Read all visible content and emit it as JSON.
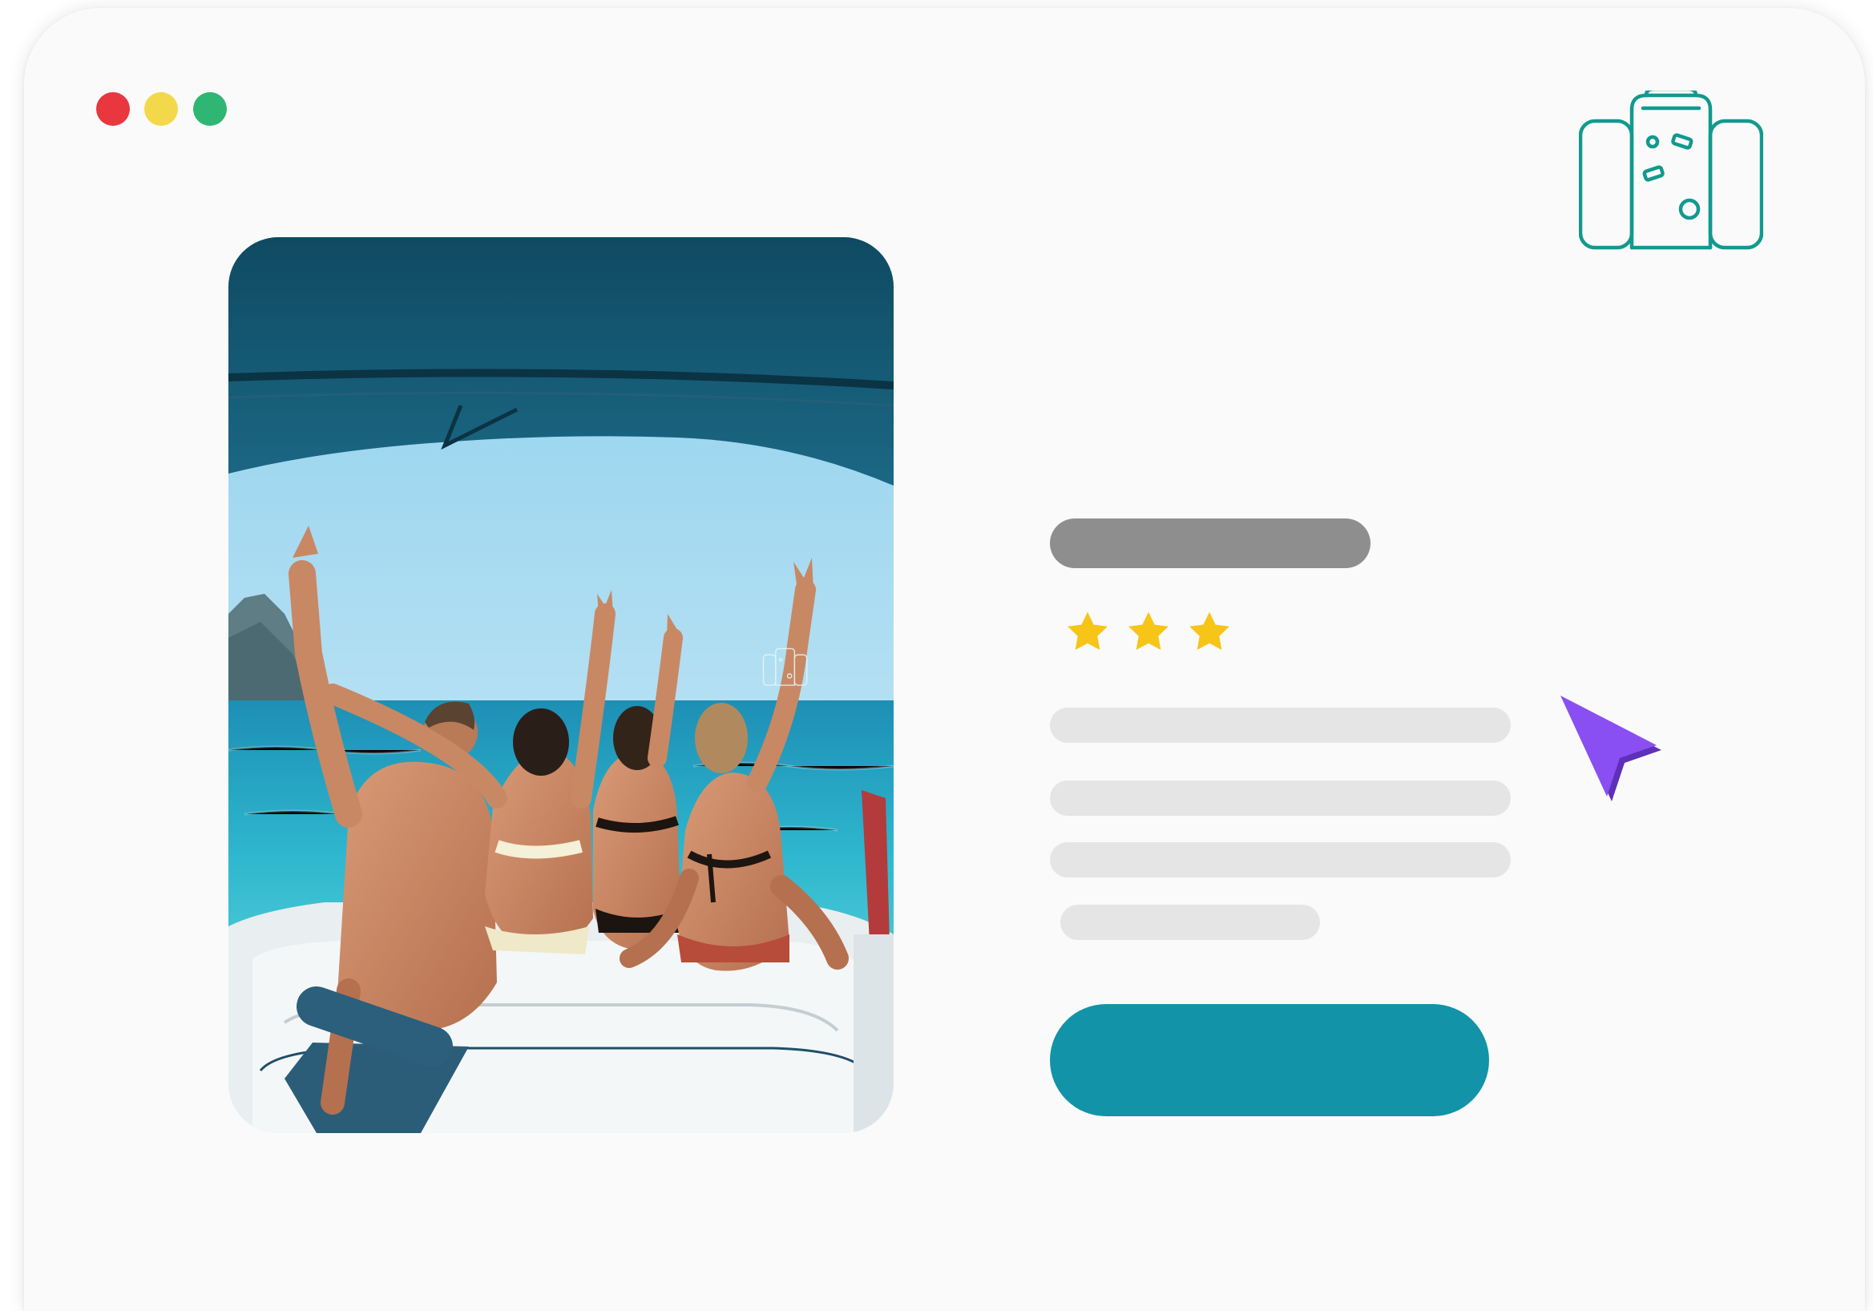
{
  "window": {
    "controls": [
      {
        "name": "close",
        "color": "#e8373f"
      },
      {
        "name": "minimize",
        "color": "#f3d94a"
      },
      {
        "name": "maximize",
        "color": "#2fb673"
      }
    ]
  },
  "brand": {
    "icon": "luggage-icon",
    "accent_color": "#12998f"
  },
  "listing": {
    "photo": {
      "icon": "boat-friends-photo",
      "watermark_icon": "luggage-icon"
    },
    "title_placeholder_color": "#8e8e8e",
    "rating": {
      "value": 3,
      "max": 3,
      "star_color": "#f7c518"
    },
    "text_placeholder_color": "#e6e5e6",
    "text_line_count": 4,
    "cta": {
      "label": "",
      "color": "#1293a8"
    }
  },
  "cursor": {
    "icon": "pointer-cursor-icon",
    "color": "#8a4ff2"
  }
}
